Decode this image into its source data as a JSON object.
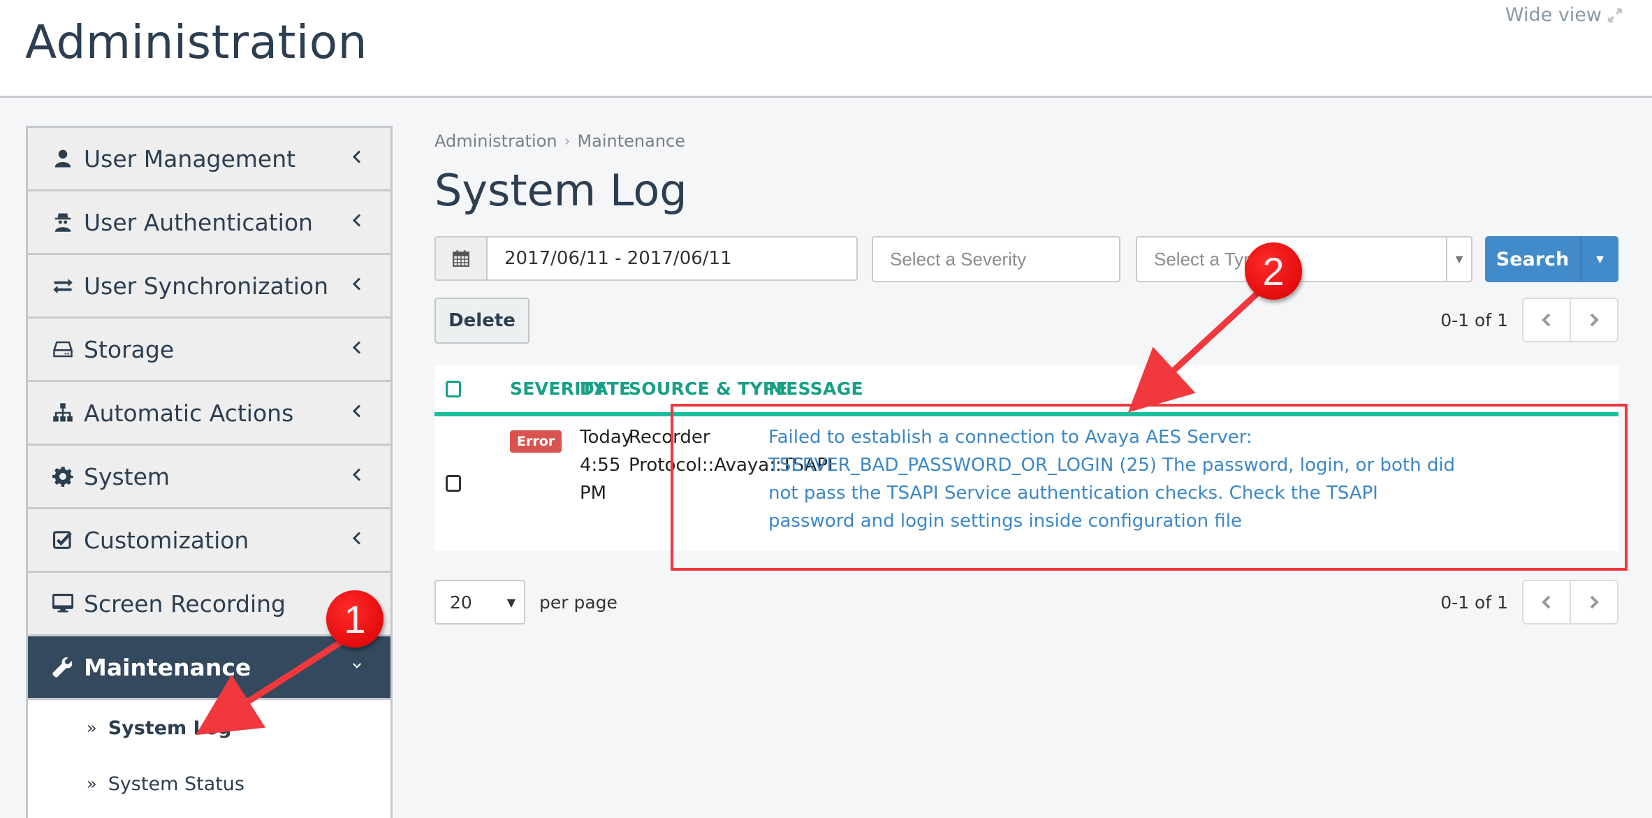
{
  "header": {
    "title": "Administration",
    "wide_view_label": "Wide view",
    "wide_view_icon": "expand-icon"
  },
  "sidebar": {
    "items": [
      {
        "label": "User Management",
        "icon": "user-icon",
        "expanded": false
      },
      {
        "label": "User Authentication",
        "icon": "user-secret-icon",
        "expanded": false
      },
      {
        "label": "User Synchronization",
        "icon": "exchange-icon",
        "expanded": false
      },
      {
        "label": "Storage",
        "icon": "hdd-icon",
        "expanded": false
      },
      {
        "label": "Automatic Actions",
        "icon": "sitemap-icon",
        "expanded": false
      },
      {
        "label": "System",
        "icon": "gear-icon",
        "expanded": false
      },
      {
        "label": "Customization",
        "icon": "check-square-icon",
        "expanded": false
      },
      {
        "label": "Screen Recording",
        "icon": "desktop-icon",
        "expanded": false
      },
      {
        "label": "Maintenance",
        "icon": "wrench-icon",
        "expanded": true,
        "active": true
      }
    ],
    "sub_items": [
      {
        "label": "System Log",
        "active": true
      },
      {
        "label": "System Status",
        "active": false
      }
    ]
  },
  "breadcrumb": [
    "Administration",
    "Maintenance"
  ],
  "page_title": "System Log",
  "filters": {
    "date_range": "2017/06/11 - 2017/06/11",
    "severity_placeholder": "Select a Severity",
    "type_placeholder": "Select a Type",
    "search_label": "Search"
  },
  "actions": {
    "delete_label": "Delete"
  },
  "pagination": {
    "range_text": "0-1 of 1",
    "per_page_value": "20",
    "per_page_label": "per page"
  },
  "table": {
    "columns": [
      "SEVERITY",
      "DATE",
      "SOURCE & TYPE",
      "MESSAGE"
    ],
    "rows": [
      {
        "severity": "Error",
        "date_line1": "Today",
        "date_line2": "4:55",
        "date_line3": "PM",
        "source": "Recorder",
        "type": "Protocol::Avaya::TSAPI",
        "message": "Failed to establish a connection to Avaya AES Server: TSERVER_BAD_PASSWORD_OR_LOGIN (25) The password, login, or both did not pass the TSAPI Service authentication checks. Check the TSAPI password and login settings inside configuration file"
      }
    ]
  },
  "annotations": {
    "marker1": "1",
    "marker2": "2",
    "color": "#f0383d"
  },
  "colors": {
    "primary_dark": "#34495e",
    "accent_teal": "#16a085",
    "search_blue": "#428bca",
    "error_red": "#d9534f",
    "link_blue": "#3c87c6"
  }
}
